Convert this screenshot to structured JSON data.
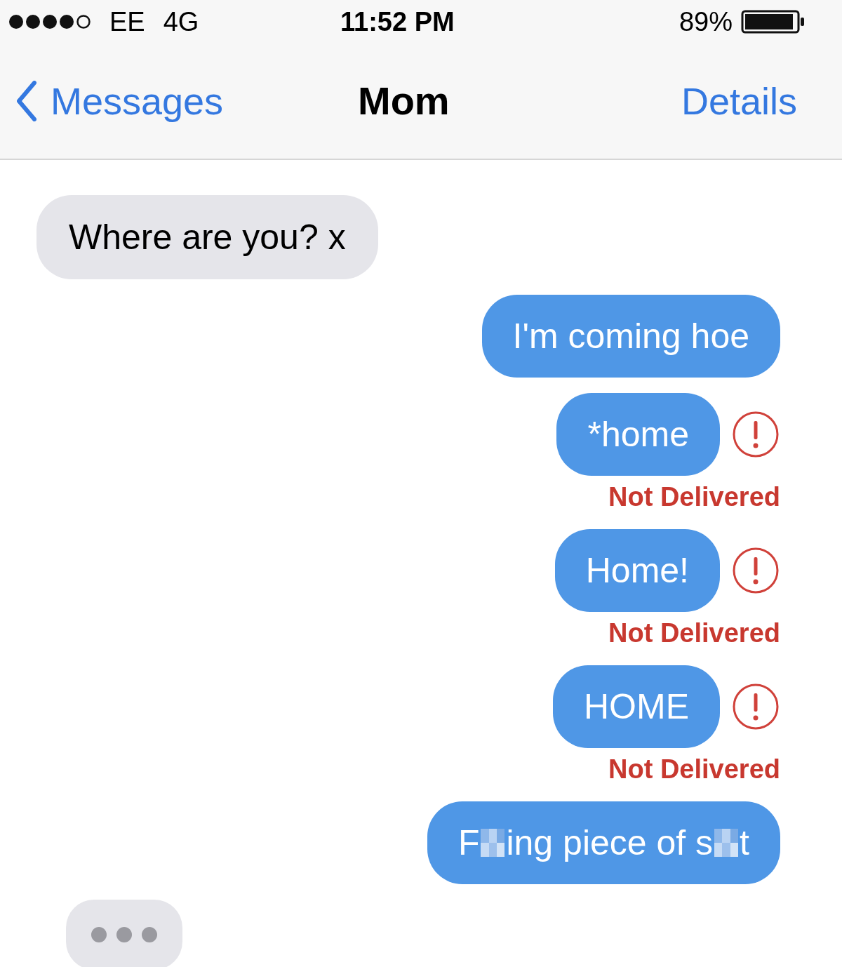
{
  "status_bar": {
    "carrier": "EE",
    "network": "4G",
    "time": "11:52 PM",
    "battery": "89%"
  },
  "nav": {
    "back": "Messages",
    "title": "Mom",
    "action": "Details"
  },
  "messages": [
    {
      "kind": "received",
      "segments": [
        {
          "kind": "text",
          "text": "Where are you? x"
        }
      ]
    },
    {
      "kind": "sent",
      "segments": [
        {
          "kind": "text",
          "text": "I'm coming hoe"
        }
      ],
      "failed": false
    },
    {
      "kind": "sent",
      "segments": [
        {
          "kind": "text",
          "text": "*home"
        }
      ],
      "failed": true,
      "status": "Not Delivered"
    },
    {
      "kind": "sent",
      "segments": [
        {
          "kind": "text",
          "text": "Home!"
        }
      ],
      "failed": true,
      "status": "Not Delivered"
    },
    {
      "kind": "sent",
      "segments": [
        {
          "kind": "text",
          "text": "HOME"
        }
      ],
      "failed": true,
      "status": "Not Delivered"
    },
    {
      "kind": "sent",
      "segments": [
        {
          "kind": "text",
          "text": "F"
        },
        {
          "kind": "censor"
        },
        {
          "kind": "text",
          "text": "ing piece of s"
        },
        {
          "kind": "censor"
        },
        {
          "kind": "text",
          "text": "t"
        }
      ],
      "failed": false
    },
    {
      "kind": "typing"
    }
  ]
}
